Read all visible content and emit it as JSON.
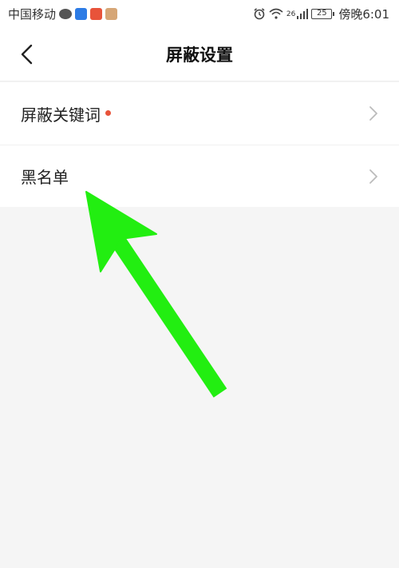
{
  "status_bar": {
    "carrier": "中国移动",
    "battery": "25",
    "network": "26",
    "time": "傍晚6:01"
  },
  "header": {
    "title": "屏蔽设置"
  },
  "settings": {
    "items": [
      {
        "label": "屏蔽关键词",
        "has_badge": true
      },
      {
        "label": "黑名单",
        "has_badge": false
      }
    ]
  },
  "colors": {
    "badge": "#e8533a",
    "arrow": "#22ee11",
    "background": "#f5f5f5"
  }
}
